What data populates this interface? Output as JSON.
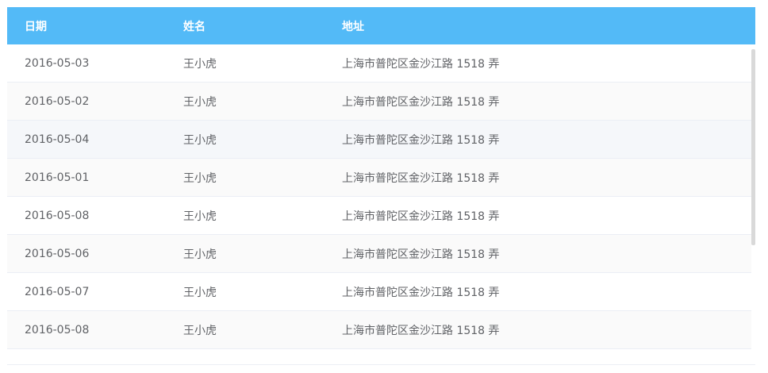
{
  "table": {
    "columns": [
      "日期",
      "姓名",
      "地址"
    ],
    "rows": [
      {
        "date": "2016-05-03",
        "name": "王小虎",
        "address": "上海市普陀区金沙江路 1518 弄"
      },
      {
        "date": "2016-05-02",
        "name": "王小虎",
        "address": "上海市普陀区金沙江路 1518 弄"
      },
      {
        "date": "2016-05-04",
        "name": "王小虎",
        "address": "上海市普陀区金沙江路 1518 弄"
      },
      {
        "date": "2016-05-01",
        "name": "王小虎",
        "address": "上海市普陀区金沙江路 1518 弄"
      },
      {
        "date": "2016-05-08",
        "name": "王小虎",
        "address": "上海市普陀区金沙江路 1518 弄"
      },
      {
        "date": "2016-05-06",
        "name": "王小虎",
        "address": "上海市普陀区金沙江路 1518 弄"
      },
      {
        "date": "2016-05-07",
        "name": "王小虎",
        "address": "上海市普陀区金沙江路 1518 弄"
      },
      {
        "date": "2016-05-08",
        "name": "王小虎",
        "address": "上海市普陀区金沙江路 1518 弄"
      },
      {
        "date": "",
        "name": "",
        "address": ""
      }
    ]
  },
  "colors": {
    "header_bg": "#53baf7",
    "header_text": "#ffffff",
    "row_text": "#606266",
    "stripe_bg": "#fafafa",
    "hover_bg": "#f5f7fa",
    "border": "#ebeef5"
  }
}
